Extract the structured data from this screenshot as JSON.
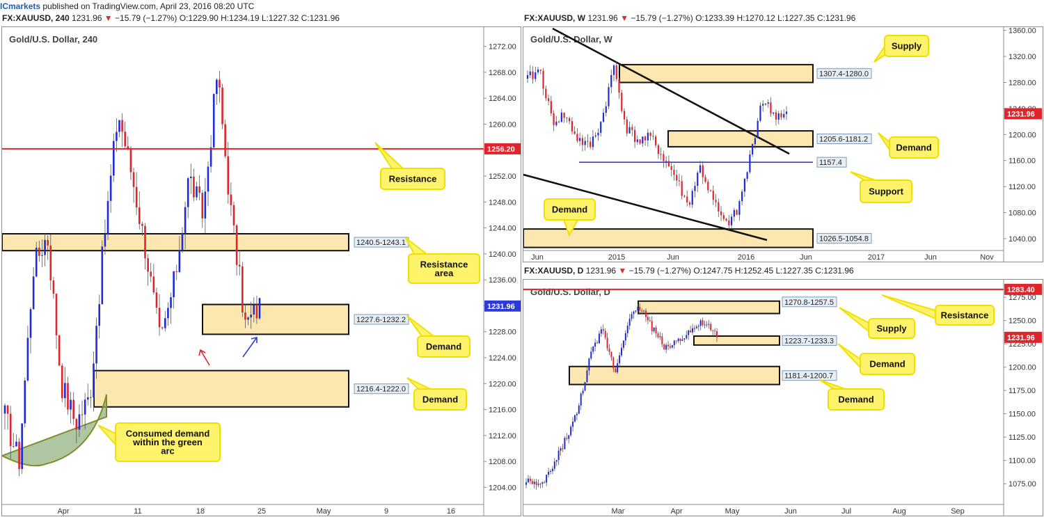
{
  "topbar": {
    "brand": "ICmarkets",
    "rest": " published on TradingView.com, April 23, 2016 08:20 UTC"
  },
  "header_left": {
    "symbol": "FX:XAUUSD, 240",
    "price": "1231.96",
    "change": "−15.79 (−1.27%)",
    "ohlc": "O:1229.90 H:1234.19 L:1227.32 C:1231.96"
  },
  "header_weekly": {
    "symbol": "FX:XAUUSD, W",
    "price": "1231.96",
    "change": "−15.79 (−1.27%)",
    "ohlc": "O:1233.39 H:1270.12 L:1227.35 C:1231.96"
  },
  "header_daily": {
    "symbol": "FX:XAUUSD, D",
    "price": "1231.96",
    "change": "−15.79 (−1.27%)",
    "ohlc": "O:1247.75 H:1252.45 L:1227.35 C:1231.96"
  },
  "colors": {
    "up": "#1f2bd6",
    "down": "#e0242b",
    "zone": "#fde7b1",
    "callout": "#fff36b",
    "callout_border": "#f0e000",
    "resistance": "#e0242b",
    "support": "#2d3bd6",
    "arc": "#8fae7c"
  },
  "chart_data": [
    {
      "type": "candlestick",
      "title": "Gold/U.S. Dollar, 240",
      "price_scale": {
        "min": 1202,
        "max": 1274,
        "ticks": [
          "1272.00",
          "1268.00",
          "1264.00",
          "1260.00",
          "1256.00",
          "1252.00",
          "1248.00",
          "1244.00",
          "1240.00",
          "1236.00",
          "1232.00",
          "1228.00",
          "1224.00",
          "1220.00",
          "1216.00",
          "1212.00",
          "1208.00",
          "1204.00"
        ]
      },
      "time_labels": [
        "Apr",
        "11",
        "18",
        "25",
        "May",
        "9",
        "16"
      ],
      "last_price": "1231.96",
      "resistance_line": {
        "value": 1256.2,
        "label": "1256.20"
      },
      "zones": [
        {
          "label": "1240.5-1243.1",
          "low": 1240.5,
          "high": 1243.1
        },
        {
          "label": "1227.6-1232.2",
          "low": 1227.6,
          "high": 1232.2
        },
        {
          "label": "1216.4-1222.0",
          "low": 1216.4,
          "high": 1222.0
        }
      ],
      "callouts": [
        "Resistance",
        "Resistance area",
        "Demand",
        "Demand",
        "Consumed demand within the green arc"
      ]
    },
    {
      "type": "candlestick",
      "title": "Gold/U.S. Dollar, W",
      "price_scale": {
        "min": 1025,
        "max": 1365,
        "ticks": [
          "1360.00",
          "1320.00",
          "1280.00",
          "1240.00",
          "1200.00",
          "1160.00",
          "1120.00",
          "1080.00",
          "1040.00"
        ]
      },
      "time_labels": [
        "Jun",
        "2015",
        "Jun",
        "2016",
        "Jun",
        "2017",
        "Jun",
        "Nov"
      ],
      "last_price": "1231.96",
      "support_line": {
        "value": 1157.4,
        "label": "1157.4"
      },
      "zones": [
        {
          "label": "1307.4-1280.0",
          "low": 1280.0,
          "high": 1307.4
        },
        {
          "label": "1205.6-1181.2",
          "low": 1181.2,
          "high": 1205.6
        },
        {
          "label": "1026.5-1054.8",
          "low": 1026.5,
          "high": 1054.8
        }
      ],
      "callouts": [
        "Supply",
        "Demand",
        "Support",
        "Demand"
      ]
    },
    {
      "type": "candlestick",
      "title": "Gold/U.S. Dollar, D",
      "price_scale": {
        "min": 1055,
        "max": 1290,
        "ticks": [
          "1275.00",
          "1250.00",
          "1225.00",
          "1200.00",
          "1175.00",
          "1150.00",
          "1125.00",
          "1100.00",
          "1075.00"
        ]
      },
      "time_labels": [
        "Mar",
        "Apr",
        "May",
        "Jun",
        "Jul",
        "Aug",
        "Sep"
      ],
      "last_price": "1231.96",
      "resistance_line": {
        "value": 1283.4,
        "label": "1283.40"
      },
      "zones": [
        {
          "label": "1270.8-1257.5",
          "low": 1257.5,
          "high": 1270.8
        },
        {
          "label": "1223.7-1233.3",
          "low": 1223.7,
          "high": 1233.3
        },
        {
          "label": "1181.4-1200.7",
          "low": 1181.4,
          "high": 1200.7
        }
      ],
      "callouts": [
        "Resistance",
        "Supply",
        "Demand",
        "Demand"
      ]
    }
  ]
}
